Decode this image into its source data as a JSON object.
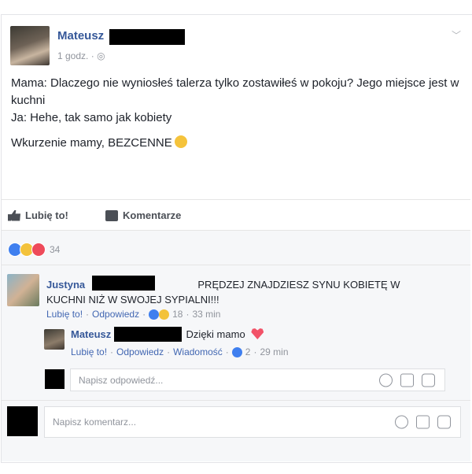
{
  "post": {
    "author": "Mateusz",
    "timestamp": "1 godz.",
    "privacy_icon": "globe-icon",
    "text_lines": [
      "Mama: Dlaczego nie wyniosłeś talerza tylko zostawiłeś w pokoju? Jego miejsce jest w kuchni",
      "Ja: Hehe, tak samo jak kobiety"
    ],
    "text_final": "Wkurzenie mamy, BEZCENNE",
    "final_emoji": "laughing-emoji-icon"
  },
  "actions": {
    "like_label": "Lubię to!",
    "comment_label": "Komentarze"
  },
  "reactions": {
    "icons": [
      "like-icon",
      "haha-icon",
      "love-icon"
    ],
    "count": "34"
  },
  "comments": [
    {
      "author": "Justyna",
      "text": "PRĘDZEJ ZNAJDZIESZ SYNU KOBIETĘ W KUCHNI NIŻ W SWOJEJ SYPIALNI!!!",
      "like": "Lubię to!",
      "reply": "Odpowiedz",
      "reaction_count": "18",
      "time": "33 min",
      "replies": [
        {
          "author": "Mateusz",
          "text": "Dzięki mamo",
          "emoji": "broken-heart-icon",
          "like": "Lubię to!",
          "reply": "Odpowiedz",
          "message": "Wiadomość",
          "reaction_count": "2",
          "time": "29 min"
        }
      ]
    }
  ],
  "reply_box": {
    "placeholder": "Napisz odpowiedź..."
  },
  "comment_box": {
    "placeholder": "Napisz komentarz..."
  },
  "colors": {
    "link": "#365899",
    "muted": "#90949c",
    "like_blue": "#3f7fef",
    "haha_yellow": "#f3c23b",
    "love_red": "#ee4a5a"
  }
}
